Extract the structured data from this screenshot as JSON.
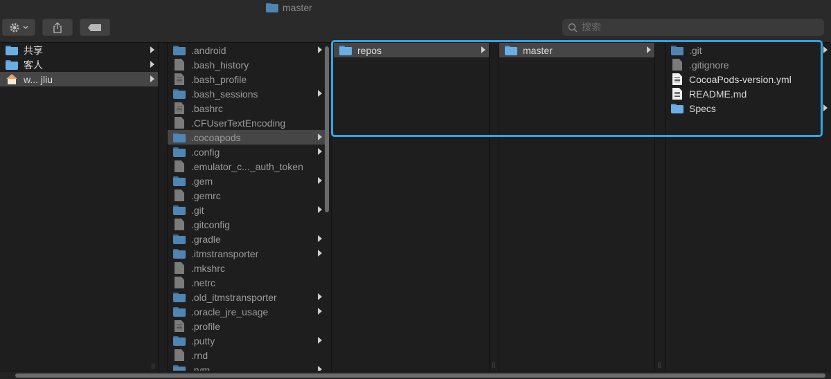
{
  "window": {
    "title": "master"
  },
  "toolbar": {
    "search_placeholder": "搜索"
  },
  "sidebar": {
    "items": [
      {
        "label": "共享",
        "icon": "folder-icon",
        "selected": false
      },
      {
        "label": "客人",
        "icon": "folder-icon",
        "selected": false
      },
      {
        "label": "w... jliu",
        "icon": "home-icon",
        "selected": true
      }
    ]
  },
  "home_column": {
    "items": [
      {
        "label": ".android",
        "icon": "folder-icon"
      },
      {
        "label": ".bash_history",
        "icon": "file-icon"
      },
      {
        "label": ".bash_profile",
        "icon": "text-file-icon"
      },
      {
        "label": ".bash_sessions",
        "icon": "folder-icon"
      },
      {
        "label": ".bashrc",
        "icon": "text-file-icon"
      },
      {
        "label": ".CFUserTextEncoding",
        "icon": "file-icon"
      },
      {
        "label": ".cocoapods",
        "icon": "folder-icon"
      },
      {
        "label": ".config",
        "icon": "folder-icon"
      },
      {
        "label": ".emulator_c..._auth_token",
        "icon": "file-icon"
      },
      {
        "label": ".gem",
        "icon": "folder-icon"
      },
      {
        "label": ".gemrc",
        "icon": "file-icon"
      },
      {
        "label": ".git",
        "icon": "folder-icon"
      },
      {
        "label": ".gitconfig",
        "icon": "file-icon"
      },
      {
        "label": ".gradle",
        "icon": "folder-icon"
      },
      {
        "label": ".itmstransporter",
        "icon": "folder-icon"
      },
      {
        "label": ".mkshrc",
        "icon": "file-icon"
      },
      {
        "label": ".netrc",
        "icon": "file-icon"
      },
      {
        "label": ".old_itmstransporter",
        "icon": "folder-icon"
      },
      {
        "label": ".oracle_jre_usage",
        "icon": "folder-icon"
      },
      {
        "label": ".profile",
        "icon": "text-file-icon"
      },
      {
        "label": ".putty",
        "icon": "folder-icon"
      },
      {
        "label": ".rnd",
        "icon": "file-icon"
      },
      {
        "label": ".rvm",
        "icon": "folder-icon"
      }
    ]
  },
  "repos_column": {
    "items": [
      {
        "label": "repos",
        "icon": "folder-icon"
      }
    ]
  },
  "master_column": {
    "items": [
      {
        "label": "master",
        "icon": "folder-icon"
      }
    ]
  },
  "specs_column": {
    "items": [
      {
        "label": ".git",
        "icon": "folder-icon"
      },
      {
        "label": ".gitignore",
        "icon": "file-icon"
      },
      {
        "label": "CocoaPods-version.yml",
        "icon": "text-file-icon"
      },
      {
        "label": "README.md",
        "icon": "text-file-icon"
      },
      {
        "label": "Specs",
        "icon": "folder-icon"
      }
    ]
  },
  "colors": {
    "highlight": "#2fa6e8",
    "folder": "#6aaee6",
    "selection": "#464646"
  }
}
